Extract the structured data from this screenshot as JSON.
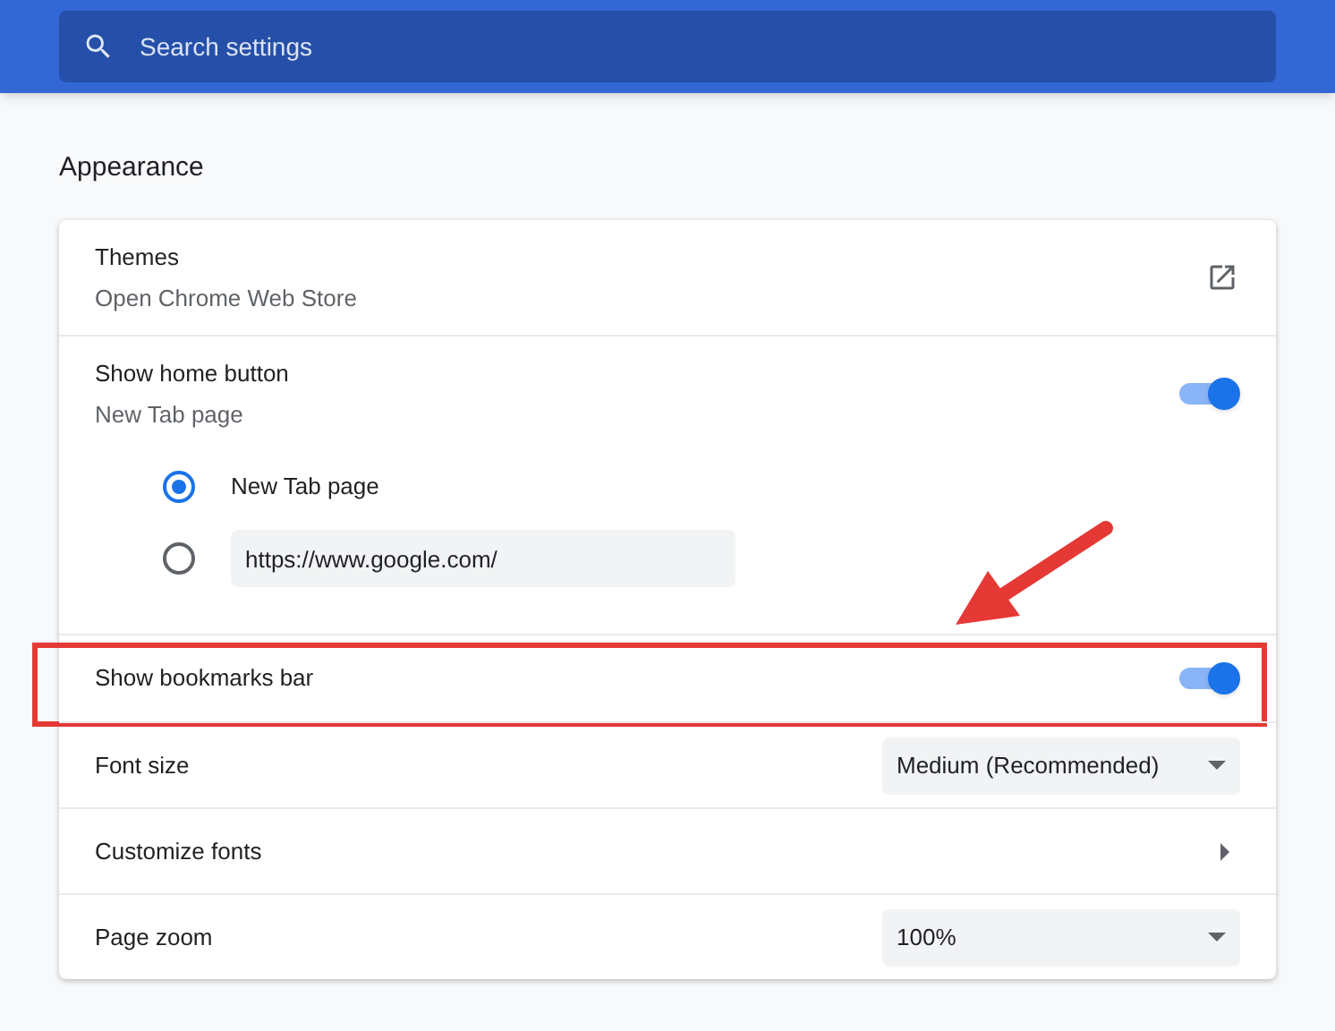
{
  "search": {
    "placeholder": "Search settings"
  },
  "section_title": "Appearance",
  "rows": [
    {
      "kind": "link",
      "title": "Themes",
      "subtitle": "Open Chrome Web Store"
    },
    {
      "kind": "toggle",
      "title": "Show home button",
      "subtitle": "New Tab page",
      "on": true,
      "options": [
        {
          "kind": "label",
          "text": "New Tab page",
          "selected": true
        },
        {
          "kind": "input",
          "value": "https://www.google.com/",
          "selected": false
        }
      ]
    },
    {
      "kind": "toggle",
      "title": "Show bookmarks bar",
      "on": true,
      "highlighted": true
    },
    {
      "kind": "dropdown",
      "title": "Font size",
      "value": "Medium (Recommended)"
    },
    {
      "kind": "submenu",
      "title": "Customize fonts"
    },
    {
      "kind": "dropdown",
      "title": "Page zoom",
      "value": "100%"
    }
  ]
}
